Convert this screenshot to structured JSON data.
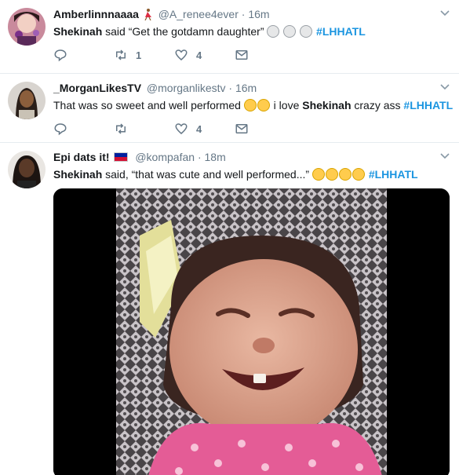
{
  "tweets": [
    {
      "name": "Amberlinnnaaaa",
      "handle": "@A_renee4ever",
      "time": "16m",
      "dot": "·",
      "speaker": "Shekinah",
      "said": " said “Get the gotdamn daughter” ",
      "hashtag": "#LHHATL",
      "retweets": "1",
      "likes": "4"
    },
    {
      "name": "_MorganLikesTV",
      "handle": "@morganlikestv",
      "time": "16m",
      "dot": "·",
      "text_before": "That was so sweet and well performed ",
      "text_middle": " i love ",
      "speaker": "Shekinah",
      "text_after": " crazy ass ",
      "hashtag": "#LHHATL",
      "retweets": "",
      "likes": "4"
    },
    {
      "name": "Epi dats it!",
      "handle": "@kompafan",
      "time": "18m",
      "dot": "·",
      "speaker": "Shekinah",
      "said": " said, “that was cute and well performed...” ",
      "hashtag": "#LHHATL"
    }
  ],
  "icons": {
    "reply": "reply-icon",
    "retweet": "retweet-icon",
    "like": "heart-icon",
    "dm": "envelope-icon",
    "caret": "chevron-down-icon"
  },
  "colors": {
    "hashtag": "#1b95e0",
    "meta": "#657786",
    "divider": "#e6ecf0"
  }
}
